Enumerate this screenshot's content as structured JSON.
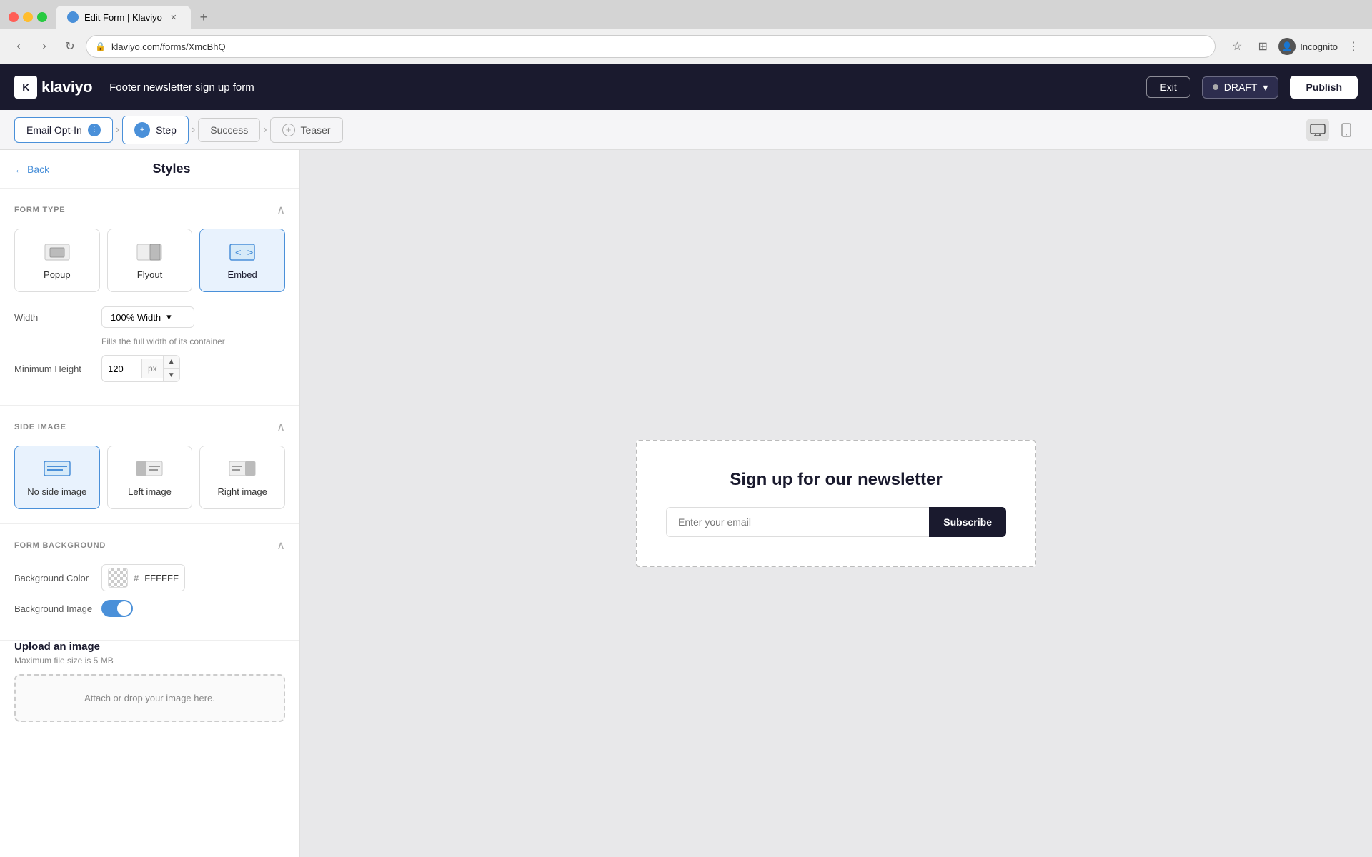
{
  "browser": {
    "url": "klaviyo.com/forms/XmcBhQ",
    "tab_title": "Edit Form | Klaviyo",
    "incognito_label": "Incognito"
  },
  "topnav": {
    "logo_text": "klaviyo",
    "form_title": "Footer newsletter sign up form",
    "exit_label": "Exit",
    "draft_label": "DRAFT",
    "publish_label": "Publish"
  },
  "workflow": {
    "steps": [
      {
        "id": "email-opt-in",
        "label": "Email Opt-In",
        "type": "option"
      },
      {
        "id": "step",
        "label": "Step",
        "type": "step"
      },
      {
        "id": "success",
        "label": "Success",
        "type": "plain"
      },
      {
        "id": "teaser",
        "label": "Teaser",
        "type": "add"
      }
    ]
  },
  "sidebar": {
    "back_label": "Back",
    "title": "Styles",
    "form_type": {
      "section_title": "FORM TYPE",
      "options": [
        {
          "id": "popup",
          "label": "Popup"
        },
        {
          "id": "flyout",
          "label": "Flyout"
        },
        {
          "id": "embed",
          "label": "Embed"
        }
      ],
      "active": "embed"
    },
    "width": {
      "label": "Width",
      "value": "100% Width",
      "hint": "Fills the full width of its container"
    },
    "min_height": {
      "label": "Minimum Height",
      "value": "120",
      "unit": "px"
    },
    "side_image": {
      "section_title": "SIDE IMAGE",
      "options": [
        {
          "id": "no-side-image",
          "label": "No side image"
        },
        {
          "id": "left-image",
          "label": "Left image"
        },
        {
          "id": "right-image",
          "label": "Right image"
        }
      ],
      "active": "no-side-image"
    },
    "form_background": {
      "section_title": "FORM BACKGROUND",
      "background_color_label": "Background Color",
      "background_color_value": "#FFFFFF",
      "background_image_label": "Background Image",
      "background_image_toggle": true
    },
    "upload": {
      "title": "Upload an image",
      "hint": "Maximum file size is 5 MB",
      "dropzone_label": "Attach or drop your image here."
    }
  },
  "preview": {
    "form_title": "Sign up for our newsletter",
    "email_placeholder": "Enter your email",
    "subscribe_label": "Subscribe"
  }
}
